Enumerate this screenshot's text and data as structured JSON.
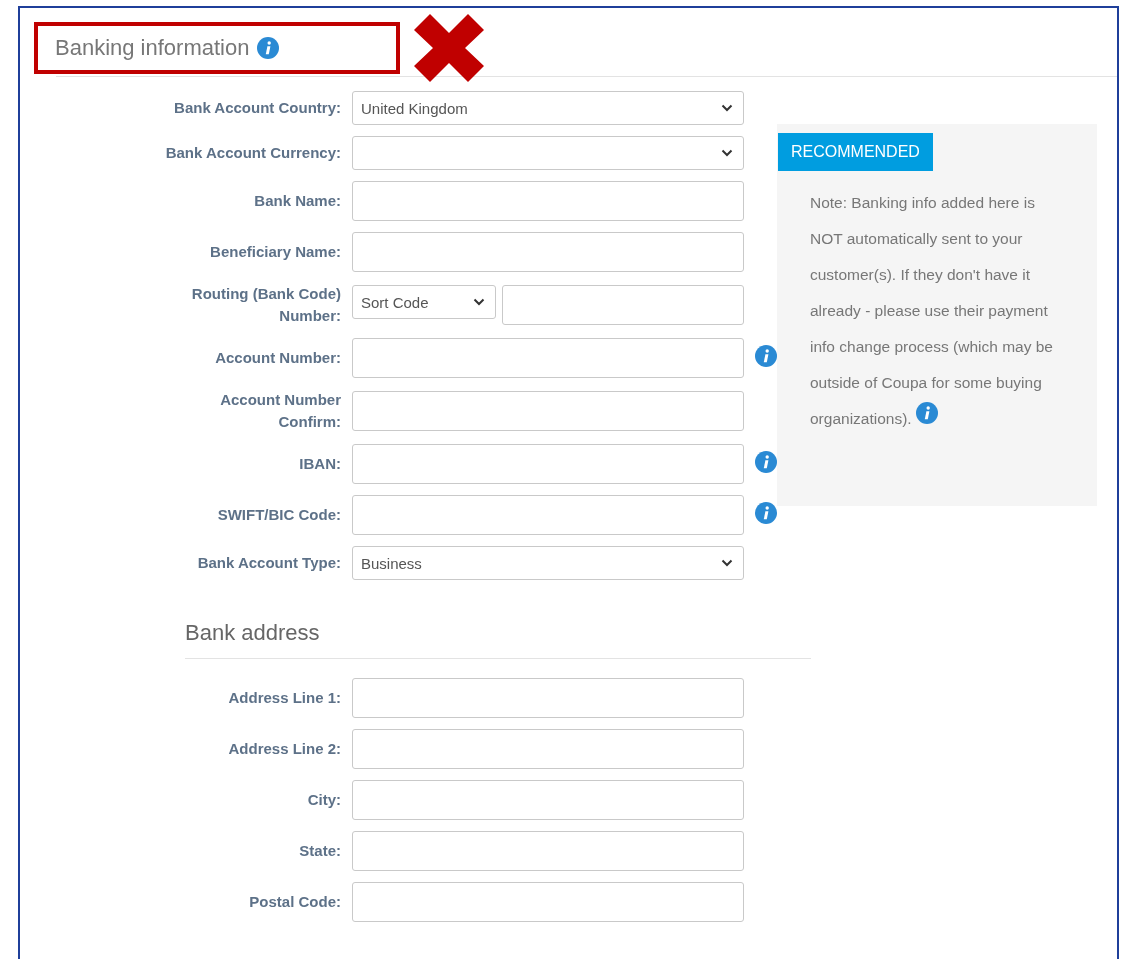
{
  "section": {
    "title": "Banking information",
    "info": true,
    "highlighted": true,
    "rejected": true
  },
  "fields": [
    {
      "label": "Bank Account Country:",
      "kind": "select",
      "value": "United Kingdom",
      "info": false
    },
    {
      "label": "Bank Account Currency:",
      "kind": "select",
      "info": false
    },
    {
      "label": "Bank Name:",
      "kind": "text",
      "info": false
    },
    {
      "label": "Beneficiary Name:",
      "kind": "text",
      "info": false
    },
    {
      "label": "Routing (Bank Code) Number:",
      "kind": "routing",
      "value": "Sort Code",
      "info": false
    },
    {
      "label": "Account Number:",
      "kind": "text",
      "info": true
    },
    {
      "label": "Account Number Confirm:",
      "kind": "text",
      "info": false
    },
    {
      "label": "IBAN:",
      "kind": "text",
      "info": true
    },
    {
      "label": "SWIFT/BIC Code:",
      "kind": "text",
      "info": true
    },
    {
      "label": "Bank Account Type:",
      "kind": "select",
      "value": "Business",
      "info": false
    }
  ],
  "recommendation": {
    "badge": "RECOMMENDED",
    "note": "Note: Banking info added here is NOT automatically sent to your customer(s). If they don't have it already - please use their payment info change process (which may be outside of Coupa for some buying organizations).",
    "info": true
  },
  "address": {
    "title": "Bank address",
    "fields": [
      {
        "label": "Address Line 1:",
        "kind": "text",
        "info": false
      },
      {
        "label": "Address Line 2:",
        "kind": "text",
        "info": false
      },
      {
        "label": "City:",
        "kind": "text",
        "info": false
      },
      {
        "label": "State:",
        "kind": "text",
        "info": false
      },
      {
        "label": "Postal Code:",
        "kind": "text",
        "info": false
      }
    ]
  }
}
